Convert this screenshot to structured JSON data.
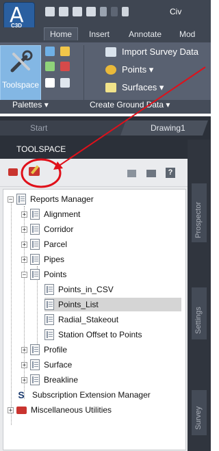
{
  "app": {
    "title_partial": "Civ",
    "logo_letter": "A",
    "logo_product": "C3D"
  },
  "ribbon_tabs": [
    "Home",
    "Insert",
    "Annotate",
    "Mod"
  ],
  "ribbon": {
    "toolspace_label": "Toolspace",
    "import_survey_data": "Import Survey Data",
    "points": "Points ▾",
    "surfaces": "Surfaces ▾",
    "palettes_panel": "Palettes ▾",
    "create_ground_data_panel": "Create Ground Data ▾"
  },
  "document_tabs": [
    "Start",
    "Drawing1"
  ],
  "toolspace": {
    "header": "TOOLSPACE",
    "help_button": "?"
  },
  "side_tabs": [
    "Prospector",
    "Settings",
    "Survey"
  ],
  "tree": {
    "root": "Reports Manager",
    "items": [
      {
        "label": "Alignment",
        "state": "+"
      },
      {
        "label": "Corridor",
        "state": "+"
      },
      {
        "label": "Parcel",
        "state": "+"
      },
      {
        "label": "Pipes",
        "state": "+"
      },
      {
        "label": "Points",
        "state": "−"
      },
      {
        "label": "Points_in_CSV"
      },
      {
        "label": "Points_List",
        "selected": true
      },
      {
        "label": "Radial_Stakeout"
      },
      {
        "label": "Station Offset to Points"
      },
      {
        "label": "Profile",
        "state": "+"
      },
      {
        "label": "Surface",
        "state": "+"
      },
      {
        "label": "Breakline",
        "state": "+"
      }
    ],
    "subscription": "Subscription Extension Manager",
    "subscription_icon": "S",
    "misc": "Miscellaneous Utilities"
  },
  "colors": {
    "annotation": "#e0101a",
    "selection": "#d5d5d5",
    "ribbon": "#596171",
    "toolspace_button": "#83b7e4"
  }
}
